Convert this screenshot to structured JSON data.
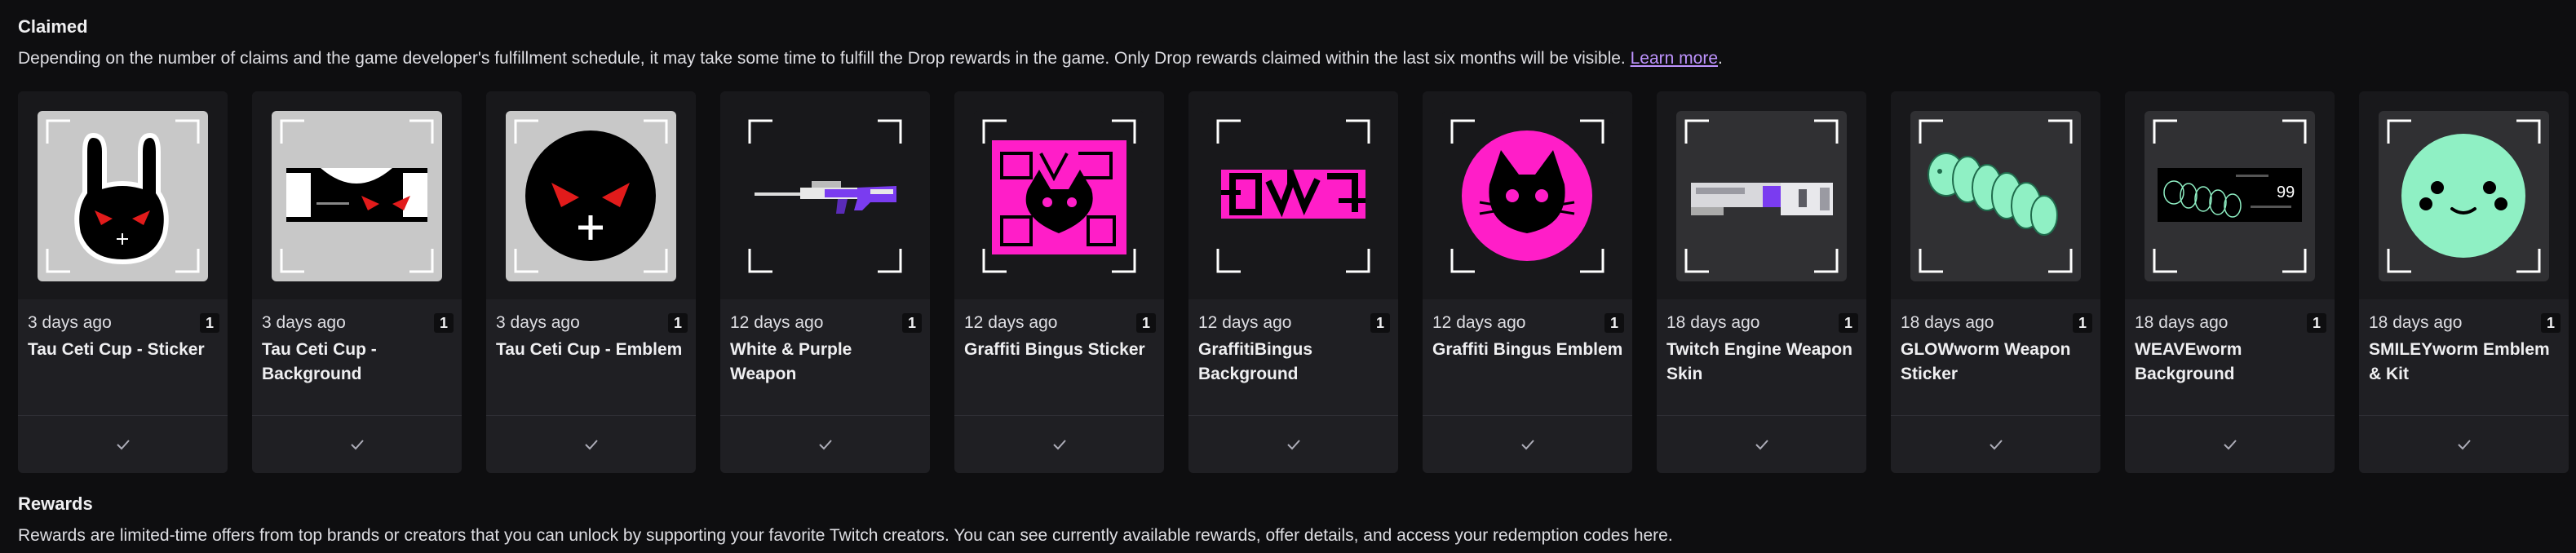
{
  "claimed": {
    "title": "Claimed",
    "description": "Depending on the number of claims and the game developer's fulfillment schedule, it may take some time to fulfill the Drop rewards in the game. Only Drop rewards claimed within the last six months will be visible.",
    "learn_more": "Learn more",
    "trailing": "."
  },
  "cards": [
    {
      "time": "3 days ago",
      "count": "1",
      "name": "Tau Ceti Cup - Sticker",
      "image_icon": "rabbit-sticker-icon"
    },
    {
      "time": "3 days ago",
      "count": "1",
      "name": "Tau Ceti Cup - Background",
      "image_icon": "rabbit-background-icon"
    },
    {
      "time": "3 days ago",
      "count": "1",
      "name": "Tau Ceti Cup - Emblem",
      "image_icon": "red-eyes-emblem-icon"
    },
    {
      "time": "12 days ago",
      "count": "1",
      "name": "White & Purple Weapon",
      "image_icon": "sniper-rifle-icon"
    },
    {
      "time": "12 days ago",
      "count": "1",
      "name": "Graffiti Bingus Sticker",
      "image_icon": "graffiti-sticker-icon"
    },
    {
      "time": "12 days ago",
      "count": "1",
      "name": "GraffitiBingus Background",
      "image_icon": "graffiti-background-icon"
    },
    {
      "time": "12 days ago",
      "count": "1",
      "name": "Graffiti Bingus Emblem",
      "image_icon": "cat-emblem-icon"
    },
    {
      "time": "18 days ago",
      "count": "1",
      "name": "Twitch Engine Weapon Skin",
      "image_icon": "weapon-skin-icon"
    },
    {
      "time": "18 days ago",
      "count": "1",
      "name": "GLOWworm Weapon Sticker",
      "image_icon": "worm-sticker-icon"
    },
    {
      "time": "18 days ago",
      "count": "1",
      "name": "WEAVEworm Background",
      "image_icon": "worm-background-icon"
    },
    {
      "time": "18 days ago",
      "count": "1",
      "name": "SMILEYworm Emblem & Kit",
      "image_icon": "smiley-emblem-icon"
    }
  ],
  "worm_background_number": "99",
  "rewards": {
    "title": "Rewards",
    "description": "Rewards are limited-time offers from top brands or creators that you can unlock by supporting your favorite Twitch creators. You can see currently available rewards, offer details, and access your redemption codes here."
  },
  "colors": {
    "background": "#0e0e10",
    "card": "#1f1f23",
    "link": "#bf94ff",
    "magenta": "#ff1ec8",
    "mint": "#8ff0c4",
    "purple": "#7a3cf0"
  }
}
